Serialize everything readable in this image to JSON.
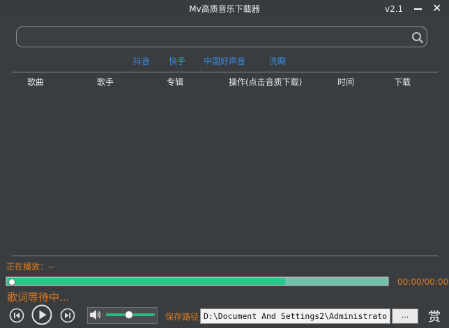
{
  "window": {
    "title": "Mv高质音乐下载器",
    "version": "v2.1",
    "close_glyph": "✕"
  },
  "search": {
    "placeholder": "",
    "value": "",
    "icon": "search-icon"
  },
  "sources": [
    {
      "label": "抖音"
    },
    {
      "label": "快手"
    },
    {
      "label": "中国好声音"
    },
    {
      "label": "洗唰"
    }
  ],
  "table": {
    "columns": [
      "歌曲",
      "歌手",
      "专辑",
      "操作(点击音质下载)",
      "时间",
      "下载"
    ],
    "rows": []
  },
  "player": {
    "now_playing_label": "正在播放：--",
    "progress_fraction": 0.73,
    "time": "00:00/00:00",
    "lyric": "歌词等待中...",
    "volume_fraction": 0.45
  },
  "save": {
    "label": "保存路径",
    "path": "D:\\Document And Settings2\\Administrato",
    "browse_label": "..."
  },
  "reward_label": "赏",
  "colors": {
    "accent_orange": "#e07a1f",
    "link_blue": "#3b8be8",
    "progress_green": "#26c98a",
    "background": "#3a3d40"
  }
}
